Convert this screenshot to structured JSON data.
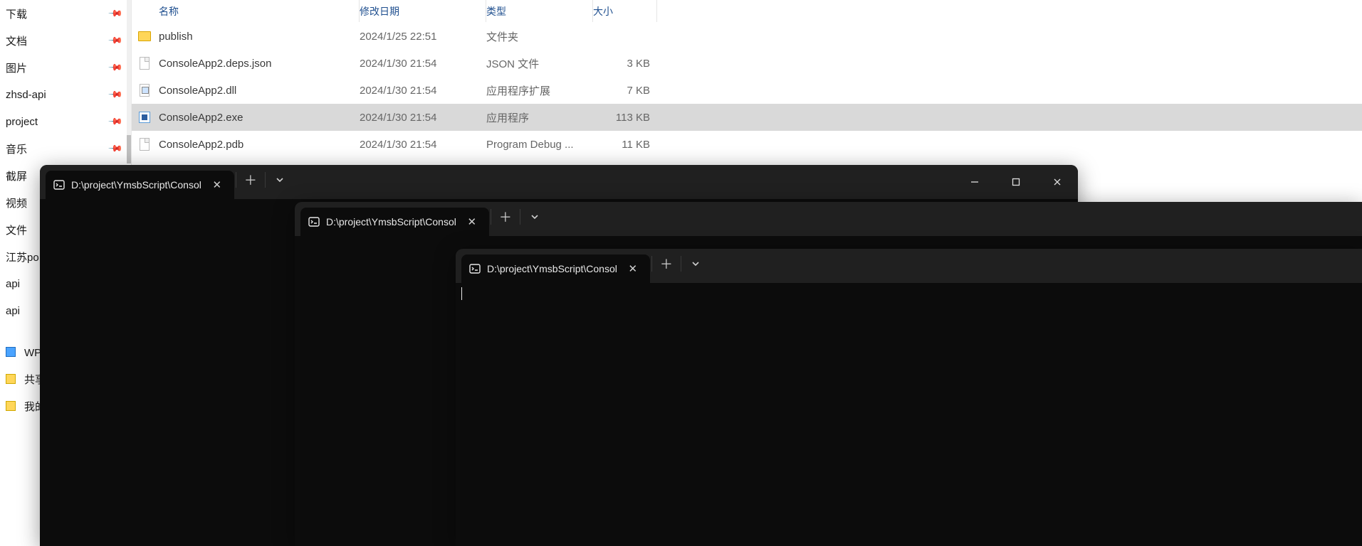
{
  "explorer": {
    "columns": {
      "name": "名称",
      "date": "修改日期",
      "type": "类型",
      "size": "大小"
    },
    "nav": [
      {
        "label": "下载",
        "pinned": true
      },
      {
        "label": "文档",
        "pinned": true
      },
      {
        "label": "图片",
        "pinned": true
      },
      {
        "label": "zhsd-api",
        "pinned": true
      },
      {
        "label": "project",
        "pinned": true
      },
      {
        "label": "音乐",
        "pinned": true
      },
      {
        "label": "截屏",
        "pinned": false
      },
      {
        "label": "视频",
        "pinned": false
      },
      {
        "label": "文件",
        "pinned": false
      },
      {
        "label": "江苏po",
        "pinned": false
      },
      {
        "label": "api",
        "pinned": false
      },
      {
        "label": "api",
        "pinned": false
      }
    ],
    "nav2": [
      {
        "label": "WPS云",
        "icon": "blue"
      },
      {
        "label": "共享文",
        "icon": "yellow"
      },
      {
        "label": "我的云",
        "icon": "yellow"
      }
    ],
    "rows": [
      {
        "icon": "folder",
        "name": "publish",
        "date": "2024/1/25 22:51",
        "type": "文件夹",
        "size": "",
        "selected": false
      },
      {
        "icon": "file",
        "name": "ConsoleApp2.deps.json",
        "date": "2024/1/30 21:54",
        "type": "JSON 文件",
        "size": "3 KB",
        "selected": false
      },
      {
        "icon": "dll",
        "name": "ConsoleApp2.dll",
        "date": "2024/1/30 21:54",
        "type": "应用程序扩展",
        "size": "7 KB",
        "selected": false
      },
      {
        "icon": "exe",
        "name": "ConsoleApp2.exe",
        "date": "2024/1/30 21:54",
        "type": "应用程序",
        "size": "113 KB",
        "selected": true
      },
      {
        "icon": "file",
        "name": "ConsoleApp2.pdb",
        "date": "2024/1/30 21:54",
        "type": "Program Debug ...",
        "size": "11 KB",
        "selected": false
      }
    ]
  },
  "terminals": {
    "t1": {
      "title": "D:\\project\\YmsbScript\\Consol",
      "showWinControls": true
    },
    "t2": {
      "title": "D:\\project\\YmsbScript\\Consol",
      "showWinControls": false
    },
    "t3": {
      "title": "D:\\project\\YmsbScript\\Consol",
      "showWinControls": false
    }
  }
}
